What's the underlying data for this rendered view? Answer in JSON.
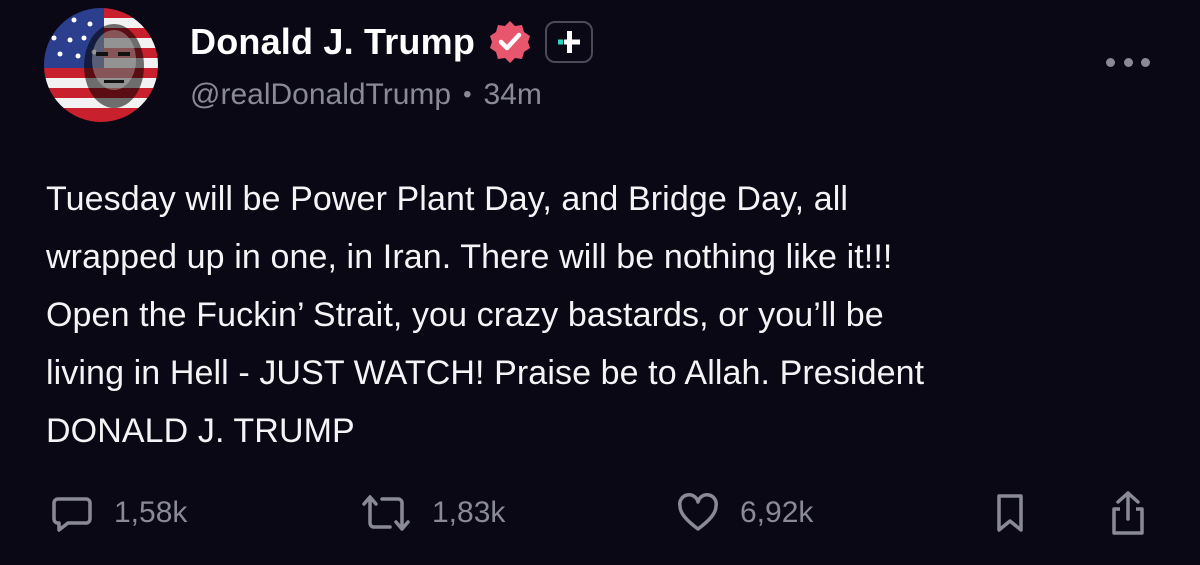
{
  "author": {
    "display_name": "Donald J. Trump",
    "handle": "@realDonaldTrump",
    "time_ago": "34m",
    "separator": "•"
  },
  "post": {
    "lines": [
      "Tuesday will be Power Plant Day, and Bridge Day, all",
      "wrapped up in one, in Iran. There will be nothing like it!!!",
      "Open the Fuckin’ Strait, you crazy bastards, or you’ll be",
      "living in Hell - JUST WATCH! Praise be to Allah. President",
      "DONALD J. TRUMP"
    ]
  },
  "actions": {
    "replies": "1,58k",
    "reposts": "1,83k",
    "likes": "6,92k"
  },
  "icons": {
    "verified": "verified-badge-icon",
    "plus": "plus-badge-icon",
    "more": "more-options-icon",
    "reply": "comment-icon",
    "repost": "repost-icon",
    "like": "heart-icon",
    "bookmark": "bookmark-icon",
    "share": "share-icon"
  },
  "colors": {
    "background": "#0a0815",
    "verified_badge": "#e8566e",
    "muted_text": "#8a8a96",
    "plus_accent": "#2fd3c4"
  }
}
